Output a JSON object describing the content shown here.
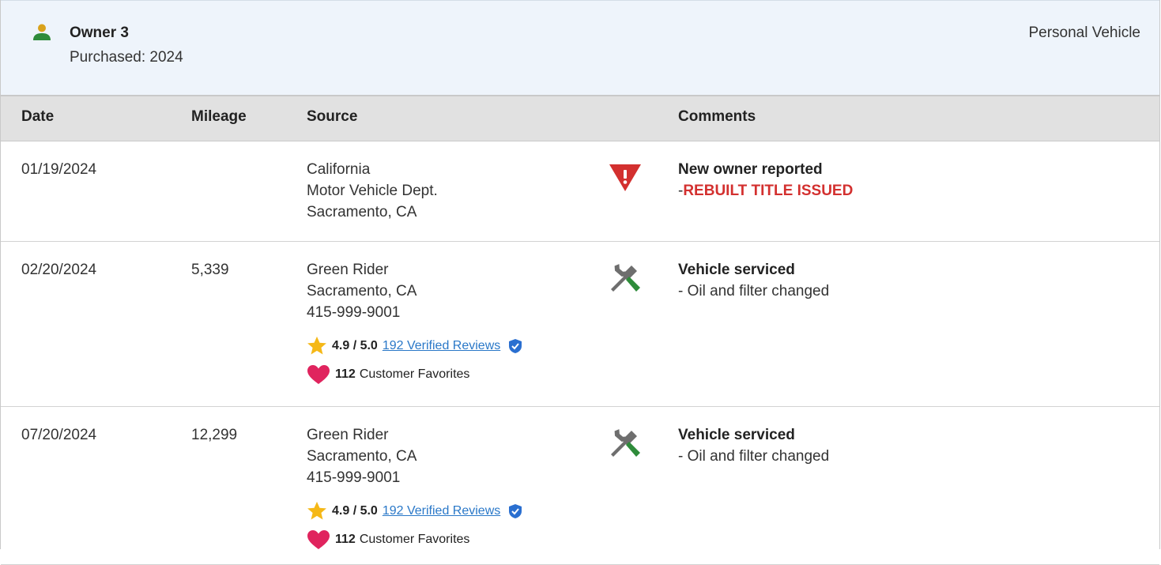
{
  "owner": {
    "title": "Owner 3",
    "purchased": "Purchased: 2024",
    "vehicle_type": "Personal Vehicle"
  },
  "table": {
    "headers": {
      "date": "Date",
      "mileage": "Mileage",
      "source": "Source",
      "comments": "Comments"
    },
    "rows": [
      {
        "date": "01/19/2024",
        "mileage": "",
        "source": [
          "California",
          "Motor Vehicle Dept.",
          "Sacramento, CA"
        ],
        "icon": "warning-triangle-icon",
        "comment_title": "New owner reported",
        "comment_prefix": "-",
        "comment_detail": "REBUILT TITLE ISSUED"
      },
      {
        "date": "02/20/2024",
        "mileage": "5,339",
        "source": [
          "Green Rider",
          "Sacramento, CA",
          "415-999-9001"
        ],
        "rating": "4.9 / 5.0",
        "reviews": "192 Verified Reviews",
        "favorites_count": "112",
        "favorites_label": "Customer Favorites",
        "icon": "wrench-screwdriver-icon",
        "comment_title": "Vehicle serviced",
        "comment_detail": "- Oil and filter changed"
      },
      {
        "date": "07/20/2024",
        "mileage": "12,299",
        "source": [
          "Green Rider",
          "Sacramento, CA",
          "415-999-9001"
        ],
        "rating": "4.9 / 5.0",
        "reviews": "192 Verified Reviews",
        "favorites_count": "112",
        "favorites_label": "Customer Favorites",
        "icon": "wrench-screwdriver-icon",
        "comment_title": "Vehicle serviced",
        "comment_detail": "- Oil and filter changed"
      }
    ]
  },
  "colors": {
    "header_bg": "#eef4fb",
    "table_header_bg": "#e1e1e1",
    "alert_red": "#d3302f",
    "link_blue": "#2a78c8",
    "tool_green": "#2e8b3a",
    "star_gold": "#f5b817",
    "heart_pink": "#e0245e",
    "person_green": "#2e8b3a",
    "person_gold": "#d9a21b"
  }
}
